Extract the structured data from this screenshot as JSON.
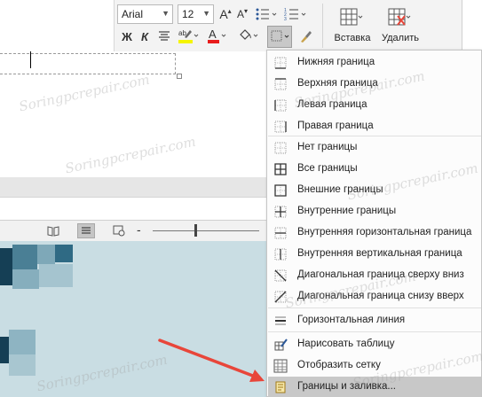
{
  "ribbon": {
    "font_name": "Arial",
    "font_size": "12",
    "bold_label": "Ж",
    "italic_label": "К",
    "insert_label": "Вставка",
    "delete_label": "Удалить",
    "grow_font_label": "A",
    "shrink_font_label": "A",
    "font_color_label": "A"
  },
  "menu": {
    "items": [
      {
        "label": "Нижняя граница",
        "icon": "border-bottom-icon"
      },
      {
        "label": "Верхняя граница",
        "icon": "border-top-icon"
      },
      {
        "label": "Левая граница",
        "icon": "border-left-icon"
      },
      {
        "label": "Правая граница",
        "icon": "border-right-icon"
      },
      {
        "label": "Нет границы",
        "icon": "border-none-icon"
      },
      {
        "label": "Все границы",
        "icon": "border-all-icon"
      },
      {
        "label": "Внешние границы",
        "icon": "border-outside-icon"
      },
      {
        "label": "Внутренние границы",
        "icon": "border-inside-icon"
      },
      {
        "label": "Внутренняя горизонтальная граница",
        "icon": "border-inside-horizontal-icon"
      },
      {
        "label": "Внутренняя вертикальная граница",
        "icon": "border-inside-vertical-icon"
      },
      {
        "label": "Диагональная граница сверху вниз",
        "icon": "border-diagonal-down-icon"
      },
      {
        "label": "Диагональная граница снизу вверх",
        "icon": "border-diagonal-up-icon"
      },
      {
        "label": "Горизонтальная линия",
        "icon": "horizontal-line-icon"
      },
      {
        "label": "Нарисовать таблицу",
        "icon": "draw-table-icon"
      },
      {
        "label": "Отобразить сетку",
        "icon": "view-gridlines-icon"
      },
      {
        "label": "Границы и заливка...",
        "icon": "borders-shading-icon"
      }
    ]
  },
  "watermark": "Soringpcrepair.com",
  "colors": {
    "highlight": "#c8c8c8",
    "arrow": "#e8463a",
    "font_color_bar": "#e81c1c",
    "highlight_bar": "#f5f500",
    "desktop": "#c9dde3"
  }
}
